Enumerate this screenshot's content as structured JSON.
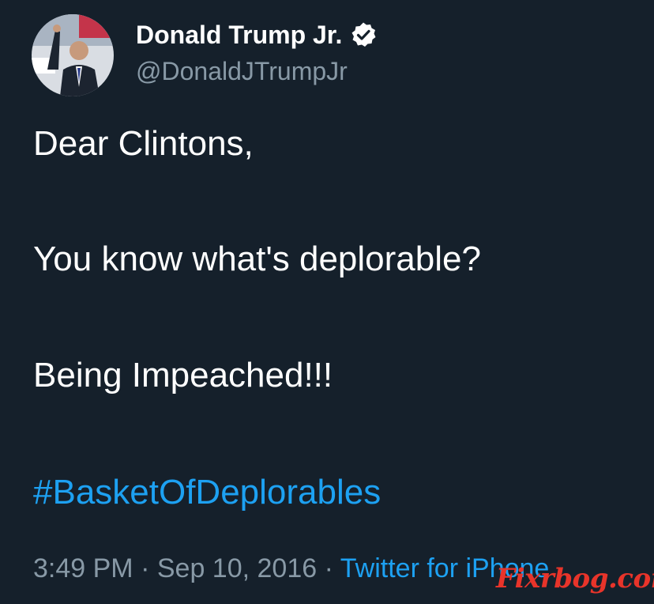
{
  "tweet": {
    "display_name": "Donald Trump Jr.",
    "handle": "@DonaldJTrumpJr",
    "verified": true,
    "body_lines": [
      "Dear Clintons,",
      "You know what's deplorable?",
      "Being Impeached!!!"
    ],
    "hashtag": "#BasketOfDeplorables",
    "time": "3:49 PM",
    "separator": "·",
    "date": "Sep 10, 2016",
    "source": "Twitter for iPhone"
  },
  "watermark": {
    "text": "Fixrbog.com"
  },
  "colors": {
    "background": "#15202b",
    "text": "#ffffff",
    "secondary": "#8899a6",
    "link": "#1da1f2",
    "watermark": "#e8342a"
  }
}
